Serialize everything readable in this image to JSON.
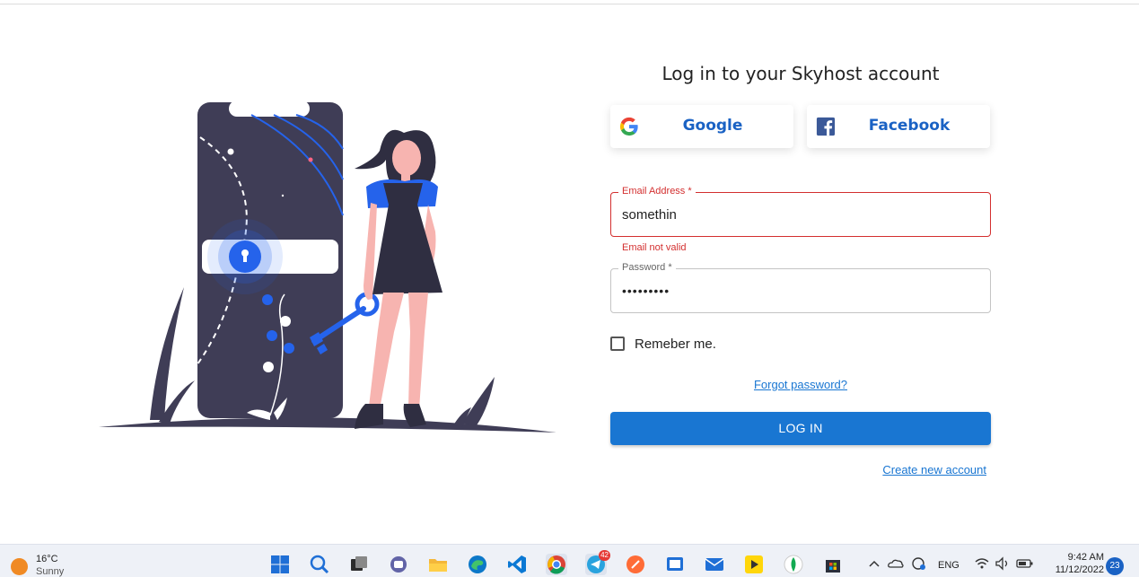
{
  "title": "Log in to your Skyhost account",
  "social": {
    "google_label": "Google",
    "facebook_label": "Facebook"
  },
  "email": {
    "label": "Email Address *",
    "value": "somethin",
    "error": "Email not valid"
  },
  "password": {
    "label": "Password *",
    "value": "•••••••••"
  },
  "remember_label": "Remeber me.",
  "forgot_label": "Forgot password?",
  "login_label": "LOG IN",
  "create_label": "Create new account",
  "colors": {
    "primary": "#1976d2",
    "error": "#d32f2f",
    "illustration_dark": "#3f3d56",
    "illustration_accent": "#2563eb",
    "skin": "#f7b4b0"
  },
  "taskbar": {
    "weather_temp": "16°C",
    "weather_condition": "Sunny",
    "apps": [
      {
        "name": "start-icon"
      },
      {
        "name": "search-icon"
      },
      {
        "name": "task-view-icon"
      },
      {
        "name": "teams-chat-icon"
      },
      {
        "name": "file-explorer-icon"
      },
      {
        "name": "edge-icon"
      },
      {
        "name": "vscode-icon"
      },
      {
        "name": "chrome-icon"
      },
      {
        "name": "telegram-icon",
        "badge": "42"
      },
      {
        "name": "postman-icon"
      },
      {
        "name": "remote-desktop-icon"
      },
      {
        "name": "mail-icon"
      },
      {
        "name": "player-icon"
      },
      {
        "name": "mongodb-compass-icon"
      },
      {
        "name": "microsoft-store-icon"
      }
    ],
    "language": "ENG",
    "time": "9:42 AM",
    "date": "11/12/2022",
    "notification_count": "23"
  }
}
